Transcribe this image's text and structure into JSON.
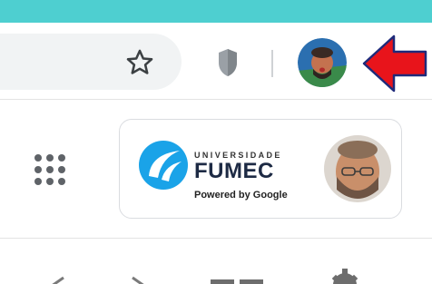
{
  "header": {
    "accent_color": "#4ecfd0"
  },
  "toolbar": {
    "bookmark_icon": "star-outline-icon",
    "extension_icon": "shield-icon",
    "profile_icon": "profile-avatar",
    "annotation_arrow_color": "#e8141b"
  },
  "account_card": {
    "org_label_small": "UNIVERSIDADE",
    "org_label_big": "FUMEC",
    "powered_by": "Powered by Google",
    "logo_color": "#1aa3e8"
  },
  "bottom_bar": {
    "icons": [
      "back-arrow-icon",
      "forward-arrow-icon",
      "menu-icon",
      "gear-icon"
    ]
  }
}
